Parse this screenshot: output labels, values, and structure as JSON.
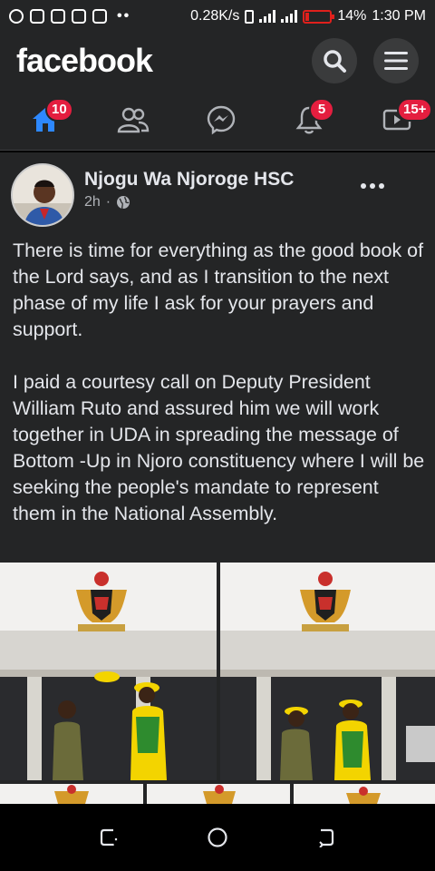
{
  "status": {
    "speed": "0.28K/s",
    "battery": "14%",
    "battery_level": 0.14,
    "time": "1:30 PM"
  },
  "header": {
    "brand": "facebook",
    "search_icon": "search-icon",
    "menu_icon": "hamburger-menu-icon"
  },
  "tabs": [
    {
      "name": "home",
      "icon": "home-icon",
      "badge": "10",
      "active": true
    },
    {
      "name": "friends",
      "icon": "friends-icon",
      "badge": ""
    },
    {
      "name": "messenger",
      "icon": "messenger-icon",
      "badge": ""
    },
    {
      "name": "notifications",
      "icon": "bell-icon",
      "badge": "5"
    },
    {
      "name": "watch",
      "icon": "video-icon",
      "badge": "15+"
    }
  ],
  "post": {
    "author": "Njogu Wa Njoroge HSC",
    "time": "2h",
    "separator": "·",
    "audience_icon": "globe-icon",
    "paragraph1": "There is time for everything as the good book of the Lord says, and as I transition to the next phase of my life I ask for your prayers and support.",
    "paragraph2": "I paid a courtesy call on Deputy President William Ruto and assured him we will work together in UDA in spreading the message of Bottom -Up in Njoro constituency where I will be  seeking the people's mandate to represent them in the National Assembly."
  },
  "colors": {
    "surface": "#242526",
    "badge": "#e41e3f",
    "active_tab": "#2d88ff",
    "text": "#e4e6eb",
    "muted": "#b0b3b8"
  }
}
